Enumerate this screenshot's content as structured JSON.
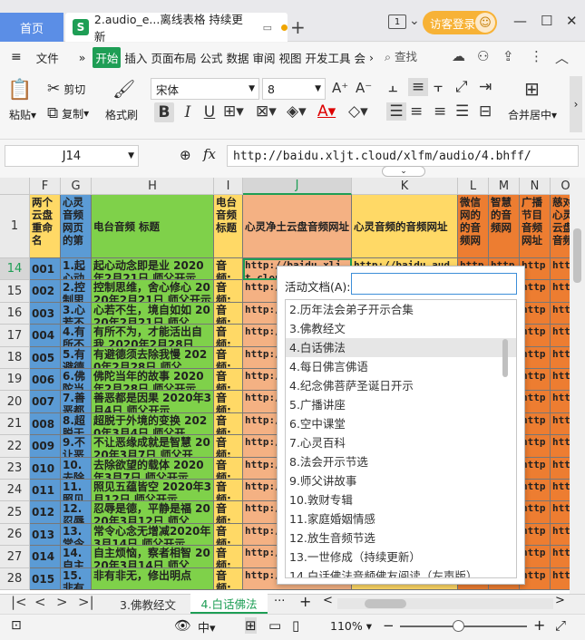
{
  "titlebar": {
    "home_tab": "首页",
    "doc_tab_icon": "S",
    "doc_tab": "2.audio_e...离线表格 持续更新",
    "window_count": "1",
    "visitor_login": "访客登录"
  },
  "menubar": {
    "file": "文件",
    "items": [
      "开始",
      "插入",
      "页面布局",
      "公式",
      "数据",
      "审阅",
      "视图",
      "开发工具",
      "会"
    ],
    "search": "查找"
  },
  "ribbon": {
    "paste": "粘贴",
    "cut": "剪切",
    "copy": "复制",
    "format_painter": "格式刷",
    "font_name": "宋体",
    "font_size": "8",
    "merge_center": "合并居中",
    "bold": "B",
    "italic": "I",
    "underline": "U"
  },
  "formula": {
    "namebox": "J14",
    "fx": "fx",
    "value": "http://baidu.xljt.cloud/xlfm/audio/4.bhff/"
  },
  "grid": {
    "columns": [
      "F",
      "G",
      "H",
      "I",
      "J",
      "K",
      "L",
      "M",
      "N",
      "O"
    ],
    "header_row": {
      "row": "1",
      "F": "两个云盘重命名",
      "G": "心灵音频网页的第",
      "H": "电台音频 标题",
      "I": "电台音频标题",
      "J": "心灵净土云盘音频网址",
      "K": "心灵音频的音频网址",
      "L": "微信网的的音频网",
      "M": "智慧的音频网",
      "N": "广播节目音频网址",
      "O": "慈对心灵云盘音频"
    },
    "rows": [
      {
        "row": "14",
        "F": "001",
        "G": "1.起心动",
        "H": "起心动念即是业 2020年2月21日 师父开示",
        "I": "音频:",
        "J": "http://baidu.xljt.cloud",
        "K": "http://baidu.audio",
        "L": "http",
        "M": "http",
        "N": "http",
        "O": "http"
      },
      {
        "row": "15",
        "F": "002",
        "G": "2.控制思",
        "H": "控制思维，舍心修心 2020年2月21日 师父开示",
        "I": "音频:",
        "J": "http://b",
        "K": "",
        "L": "http",
        "M": "http",
        "N": "http",
        "O": "http"
      },
      {
        "row": "16",
        "F": "003",
        "G": "3.心若不生",
        "H": "心若不生，境自如如 2020年2月21日 师父",
        "I": "音频:",
        "J": "http://b",
        "K": "",
        "L": "http",
        "M": "http",
        "N": "http",
        "O": "http"
      },
      {
        "row": "17",
        "F": "004",
        "G": "4.有所不为",
        "H": "有所不为，才能活出自我 2020年2月28日",
        "I": "音频:",
        "J": "http://b",
        "K": "",
        "L": "http",
        "M": "http",
        "N": "http",
        "O": "http"
      },
      {
        "row": "18",
        "F": "005",
        "G": "5.有避德",
        "H": "有避德须去除我慢 2020年2月28日 师父",
        "I": "音频:",
        "J": "http://b",
        "K": "",
        "L": "http",
        "M": "http",
        "N": "http",
        "O": "http"
      },
      {
        "row": "19",
        "F": "006",
        "G": "6.佛陀当年",
        "H": "佛陀当年的故事 2020年2月28日 师父开示",
        "I": "音频:",
        "J": "http://b",
        "K": "",
        "L": "http",
        "M": "http",
        "N": "http",
        "O": "http"
      },
      {
        "row": "20",
        "F": "007",
        "G": "7.善恶都",
        "H": "善恶都是因果 2020年3月4日 师父开示",
        "I": "音频:",
        "J": "http://b",
        "K": "",
        "L": "http",
        "M": "http",
        "N": "http",
        "O": "http"
      },
      {
        "row": "21",
        "F": "008",
        "G": "8.超脱于",
        "H": "超脱于外境的变换 2020年3月4日 师父开",
        "I": "音频:",
        "J": "http://b",
        "K": "",
        "L": "http",
        "M": "http",
        "N": "http",
        "O": "http"
      },
      {
        "row": "22",
        "F": "009",
        "G": "9.不让恶",
        "H": "不让恶缘成就是智慧 2020年3月7日 师父开",
        "I": "音频:",
        "J": "http://b",
        "K": "",
        "L": "http",
        "M": "http",
        "N": "http",
        "O": "http"
      },
      {
        "row": "23",
        "F": "010",
        "G": "10.去除欲",
        "H": "去除欲望的载体 2020年3月7日 师父开示",
        "I": "音频:",
        "J": "http://b",
        "K": "",
        "L": "http",
        "M": "http",
        "N": "http",
        "O": "http"
      },
      {
        "row": "24",
        "F": "011",
        "G": "11.照见五",
        "H": "照见五蕴皆空 2020年3月12日 师父开示",
        "I": "音频:",
        "J": "http://b",
        "K": "",
        "L": "http",
        "M": "http",
        "N": "http",
        "O": "http"
      },
      {
        "row": "25",
        "F": "012",
        "G": "12.忍辱是",
        "H": "忍辱是德，平静是福 2020年3月12日 师父",
        "I": "音频:",
        "J": "http://b",
        "K": "",
        "L": "http",
        "M": "http",
        "N": "http",
        "O": "http"
      },
      {
        "row": "26",
        "F": "013",
        "G": "13.常令心",
        "H": "常令心念无增减2020年3月14日 师父开示",
        "I": "音频:",
        "J": "http://b",
        "K": "",
        "L": "http",
        "M": "http",
        "N": "http",
        "O": "http"
      },
      {
        "row": "27",
        "F": "014",
        "G": "14.自主烦",
        "H": "自主烦恼，察者相智 2020年3月14日 师父",
        "I": "音频:",
        "J": "http://b",
        "K": "",
        "L": "http",
        "M": "http",
        "N": "http",
        "O": "http"
      },
      {
        "row": "28",
        "F": "015",
        "G": "15.非有非",
        "H": "非有非无，修出明点",
        "I": "音频:",
        "J": "http://b",
        "K": "",
        "L": "http",
        "M": "http",
        "N": "http",
        "O": "http"
      }
    ]
  },
  "dropdown": {
    "label": "活动文档(A):",
    "input_value": "",
    "items": [
      "2.历年法会弟子开示合集",
      "3.佛教经文",
      "4.白话佛法",
      "4.每日佛言佛语",
      "4.纪念佛菩萨圣诞日开示",
      "5.广播讲座",
      "6.空中课堂",
      "7.心灵百科",
      "8.法会开示节选",
      "9.师父讲故事",
      "10.敦财专辑",
      "11.家庭婚姻情感",
      "12.放生音频节选",
      "13.一世修成（持续更新）",
      "14.白话佛法音频佛友阅读（左声版）"
    ],
    "selected_index": 2
  },
  "sheets": {
    "tab_prev": "3.佛教经文",
    "tab_active": "4.白话佛法",
    "more": "···"
  },
  "status": {
    "zoom": "110%",
    "zoom_fraction": 0.46
  },
  "colors": {
    "blue": "#5b9bd5",
    "green": "#7fd14a",
    "peach": "#f4b183",
    "yellow": "#ffd966",
    "orange": "#ed7d31",
    "sel": "#1e9e55"
  }
}
